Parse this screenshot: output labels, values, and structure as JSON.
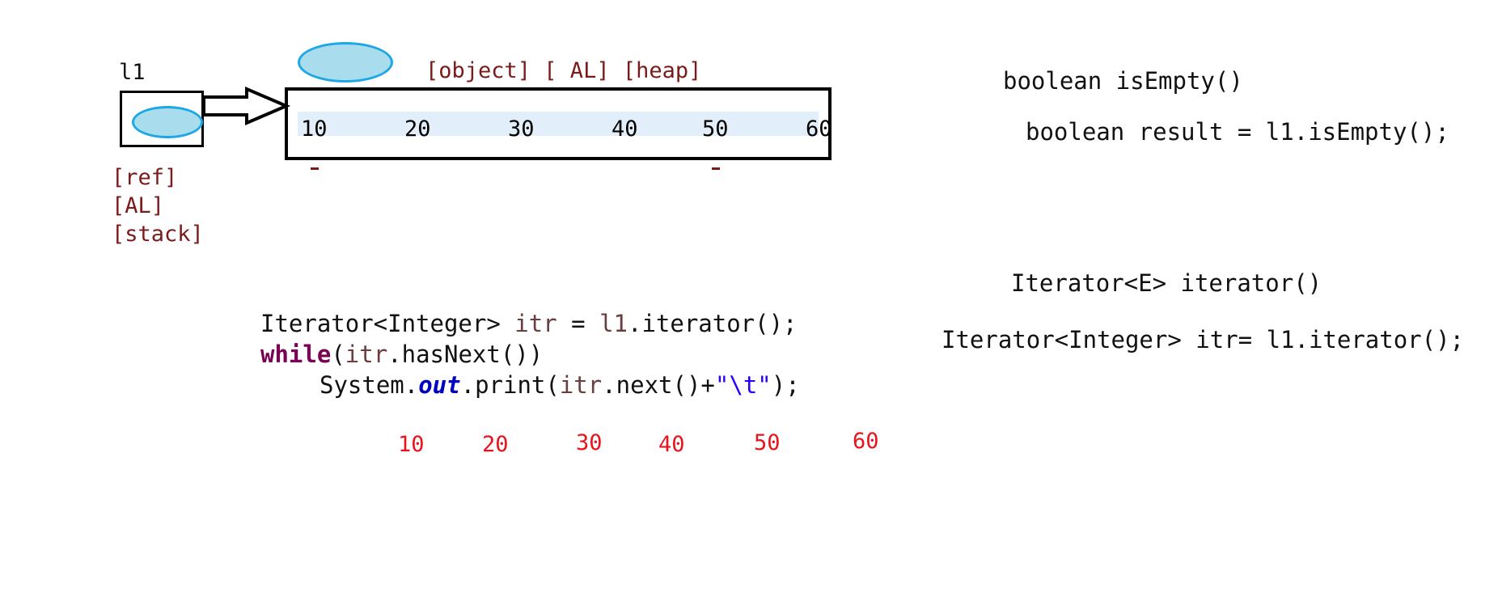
{
  "stack": {
    "var_name": "l1",
    "labels": [
      "[ref]",
      "[AL]",
      "[stack]"
    ]
  },
  "heap": {
    "label": "[object] [ AL] [heap]",
    "values": [
      "10",
      "20",
      "30",
      "40",
      "50",
      "60"
    ]
  },
  "code": {
    "line1": {
      "type": "Iterator<Integer> ",
      "var": "itr",
      "rest1": " = ",
      "obj": "l1",
      "rest2": ".iterator();"
    },
    "line2": {
      "kw": "while",
      "p1": "(",
      "var": "itr",
      "rest": ".hasNext())"
    },
    "line3": {
      "pre": "System.",
      "field": "out",
      "mid": ".print(",
      "var": "itr",
      "call": ".next()+",
      "str": "\"\\t\"",
      "end": ");"
    }
  },
  "output_values": [
    "10",
    "20",
    "30",
    "40",
    "50",
    "60"
  ],
  "notes": {
    "is_empty_sig": "boolean isEmpty()",
    "is_empty_use": "boolean result = l1.isEmpty();",
    "iterator_sig": "Iterator<E> iterator()",
    "iterator_use": "Iterator<Integer> itr= l1.iterator();"
  },
  "colors": {
    "oval_border": "#1ca7e6",
    "oval_fill": "#a9dcec",
    "label_dark_red": "#7b1a1a",
    "output_red": "#e8141c",
    "keyword_purple": "#7a0055",
    "field_blue": "#0000c0",
    "string_blue": "#2a00ff"
  }
}
